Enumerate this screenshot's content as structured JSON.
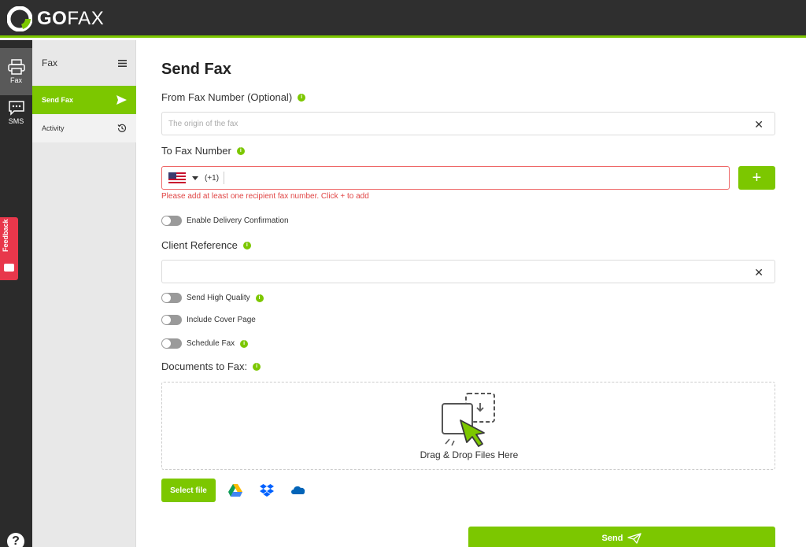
{
  "brand": {
    "name_bold": "GO",
    "name_light": "FAX",
    "accent": "#7cc700"
  },
  "rail": {
    "items": [
      {
        "label": "Fax",
        "icon": "printer-icon"
      },
      {
        "label": "SMS",
        "icon": "chat-icon"
      }
    ],
    "help": "?",
    "feedback_label": "Feedback"
  },
  "subnav": {
    "title": "Fax",
    "items": [
      {
        "label": "Send Fax",
        "icon": "send-icon"
      },
      {
        "label": "Activity",
        "icon": "history-icon"
      }
    ]
  },
  "form": {
    "title": "Send Fax",
    "from_label": "From Fax Number (Optional)",
    "from_placeholder": "The origin of the fax",
    "to_label": "To Fax Number",
    "dial_code": "(+1)",
    "to_error": "Please add at least one recipient fax number. Click + to add",
    "add_button": "+",
    "delivery_toggle": "Enable Delivery Confirmation",
    "client_ref_label": "Client Reference",
    "high_quality_toggle": "Send High Quality",
    "cover_page_toggle": "Include Cover Page",
    "schedule_toggle": "Schedule Fax",
    "documents_label": "Documents to Fax:",
    "drop_text": "Drag & Drop Files Here",
    "select_file": "Select file",
    "send_button": "Send",
    "info_glyph": "i",
    "clear_glyph": "✕"
  }
}
